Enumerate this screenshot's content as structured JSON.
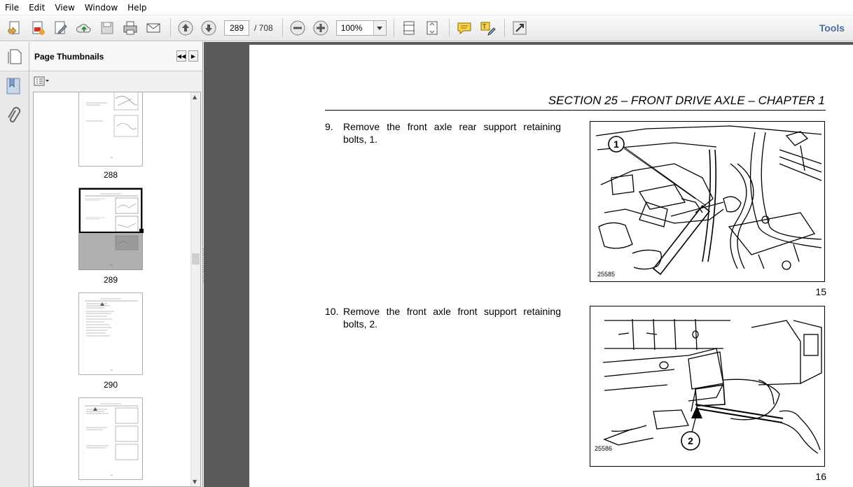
{
  "menu": [
    "File",
    "Edit",
    "View",
    "Window",
    "Help"
  ],
  "toolbar": {
    "page_current": "289",
    "page_total": "/ 708",
    "zoom": "100%",
    "tools_label": "Tools"
  },
  "panel": {
    "title": "Page Thumbnails",
    "thumbnails": [
      {
        "label": "288"
      },
      {
        "label": "289"
      },
      {
        "label": "290"
      }
    ]
  },
  "document": {
    "section_title": "SECTION 25 – FRONT DRIVE AXLE – CHAPTER 1",
    "steps": [
      {
        "num": "9.",
        "text": "Remove the front axle rear support retaining bolts, 1.",
        "figure_code": "25585",
        "callout": "1",
        "figure_number": "15"
      },
      {
        "num": "10.",
        "text": "Remove the front axle front support retaining bolts, 2.",
        "figure_code": "25586",
        "callout": "2",
        "figure_number": "16"
      }
    ]
  }
}
